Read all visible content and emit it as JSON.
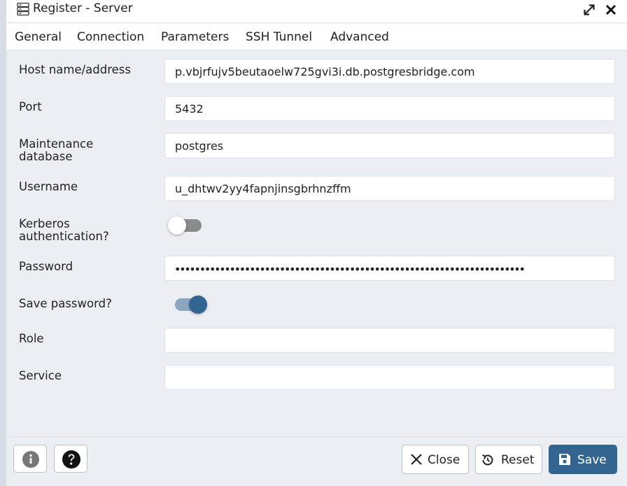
{
  "window": {
    "title": "Register - Server",
    "title_icon": "server-icon",
    "expand_icon": "expand-icon",
    "close_icon": "close-icon"
  },
  "tabs": [
    {
      "label": "General",
      "active": false
    },
    {
      "label": "Connection",
      "active": true
    },
    {
      "label": "Parameters",
      "active": false
    },
    {
      "label": "SSH Tunnel",
      "active": false
    },
    {
      "label": "Advanced",
      "active": false
    }
  ],
  "form": {
    "host": {
      "label": "Host name/address",
      "value": "p.vbjrfujv5beutaoelw725gvi3i.db.postgresbridge.com"
    },
    "port": {
      "label": "Port",
      "value": "5432"
    },
    "maintenance_db": {
      "label_line1": "Maintenance",
      "label_line2": "database",
      "value": "postgres"
    },
    "username": {
      "label": "Username",
      "value": "u_dhtwv2yy4fapnjinsgbrhnzffm"
    },
    "kerberos": {
      "label_line1": "Kerberos",
      "label_line2": "authentication?",
      "enabled": false
    },
    "password": {
      "label": "Password",
      "masked_value": "••••••••••••••••••••••••••••••••••••••••••••••••••••••••••••••••••••••"
    },
    "save_password": {
      "label": "Save password?",
      "enabled": true
    },
    "role": {
      "label": "Role",
      "value": ""
    },
    "service": {
      "label": "Service",
      "value": ""
    }
  },
  "footer": {
    "info_icon": "info-icon",
    "help_icon": "help-icon",
    "close_label": "Close",
    "reset_label": "Reset",
    "save_label": "Save"
  },
  "colors": {
    "accent": "#326690",
    "form_bg": "#ebeef3",
    "toggle_off": "#8b8b8b",
    "toggle_on_track": "#8ba6c1"
  }
}
